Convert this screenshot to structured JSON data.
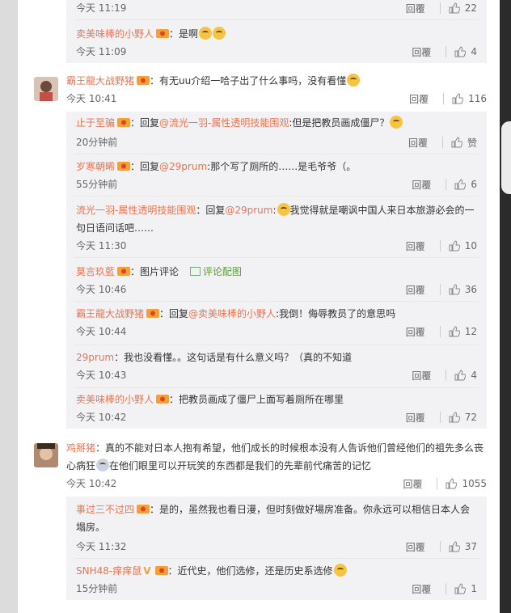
{
  "colors": {
    "accent": "#eb7350",
    "link": "#eb7350",
    "pic": "#5b9a3b",
    "muted": "#666666"
  },
  "icons": {
    "like": "thumb-up-icon",
    "vip_badge": "member-badge-icon",
    "emoji": "emoji-icon"
  },
  "top_subs": [
    {
      "time": "今天 11:19",
      "reply": "回覆",
      "likes": "22"
    },
    {
      "user": "卖美味棒的小野人",
      "text": "：是啊",
      "time": "今天 11:09",
      "reply": "回覆",
      "likes": "4"
    }
  ],
  "comments": [
    {
      "user": "霸王龍大战野猪",
      "text": "：有无uu介绍一哈子出了什么事吗，没有看懂",
      "time": "今天 10:41",
      "reply": "回覆",
      "likes": "116",
      "subs": [
        {
          "user": "止于至骗",
          "pre": "：回复",
          "mention": "@流光一羽-属性透明技能围观",
          "text": ":但是把教员画成僵尸？",
          "time": "20分钟前",
          "reply": "回覆",
          "likes": "赞"
        },
        {
          "user": "岁寒朝晞",
          "pre": "：回复",
          "mention": "@29prum",
          "text": ":那个写了厕所的……是毛爷爷（。",
          "time": "55分钟前",
          "reply": "回覆",
          "likes": "6"
        },
        {
          "user": "流光一羽-属性透明技能围观",
          "pre": "：回复",
          "mention": "@29prum",
          "text": ":",
          "text2": "我觉得就是嘲讽中国人来日本旅游必会的一",
          "text3": "句日语问话吧……",
          "time": "今天 11:30",
          "reply": "回覆",
          "likes": "10"
        },
        {
          "user": "莫言玖藍",
          "text": "：图片评论",
          "pic": "评论配图",
          "time": "今天 10:46",
          "reply": "回覆",
          "likes": "36"
        },
        {
          "user": "霸王龍大战野猪",
          "pre": "：回复",
          "mention": "@卖美味棒的小野人",
          "text": ":我倒！侮辱教员了的意思吗",
          "time": "今天 10:44",
          "reply": "回覆",
          "likes": "12"
        },
        {
          "user": "29prum",
          "text": "：我也没看懂。。这句话是有什么意义吗？（真的不知道",
          "time": "今天 10:43",
          "reply": "回覆",
          "likes": "4"
        },
        {
          "user": "卖美味棒的小野人",
          "text": "：把教员画成了僵尸上面写着厕所在哪里",
          "time": "今天 10:42",
          "reply": "回覆",
          "likes": "72"
        }
      ]
    },
    {
      "user": "鸡掰猪",
      "text": "：真的不能对日本人抱有希望，他们成长的时候根本没有人告诉他们曾经他们的祖先多么丧",
      "text_line2a": "心病狂",
      "text_line2b": "在他们眼里可以开玩笑的东西都是我们的先辈前代痛苦的记忆",
      "time": "今天 10:42",
      "reply": "回覆",
      "likes": "1055",
      "subs": [
        {
          "user": "事过三不过四",
          "text": "：是的，虽然我也看日漫，但时刻做好場房准备。你永远可以相信日本人会",
          "text2": "塌房。",
          "time": "今天 11:32",
          "reply": "回覆",
          "likes": "37"
        },
        {
          "user": "SNH48-痒痒鼠",
          "text": "：近代史，他们选修，还是历史系选修",
          "time": "15分钟前",
          "reply": "回覆",
          "likes": "1"
        }
      ]
    }
  ]
}
